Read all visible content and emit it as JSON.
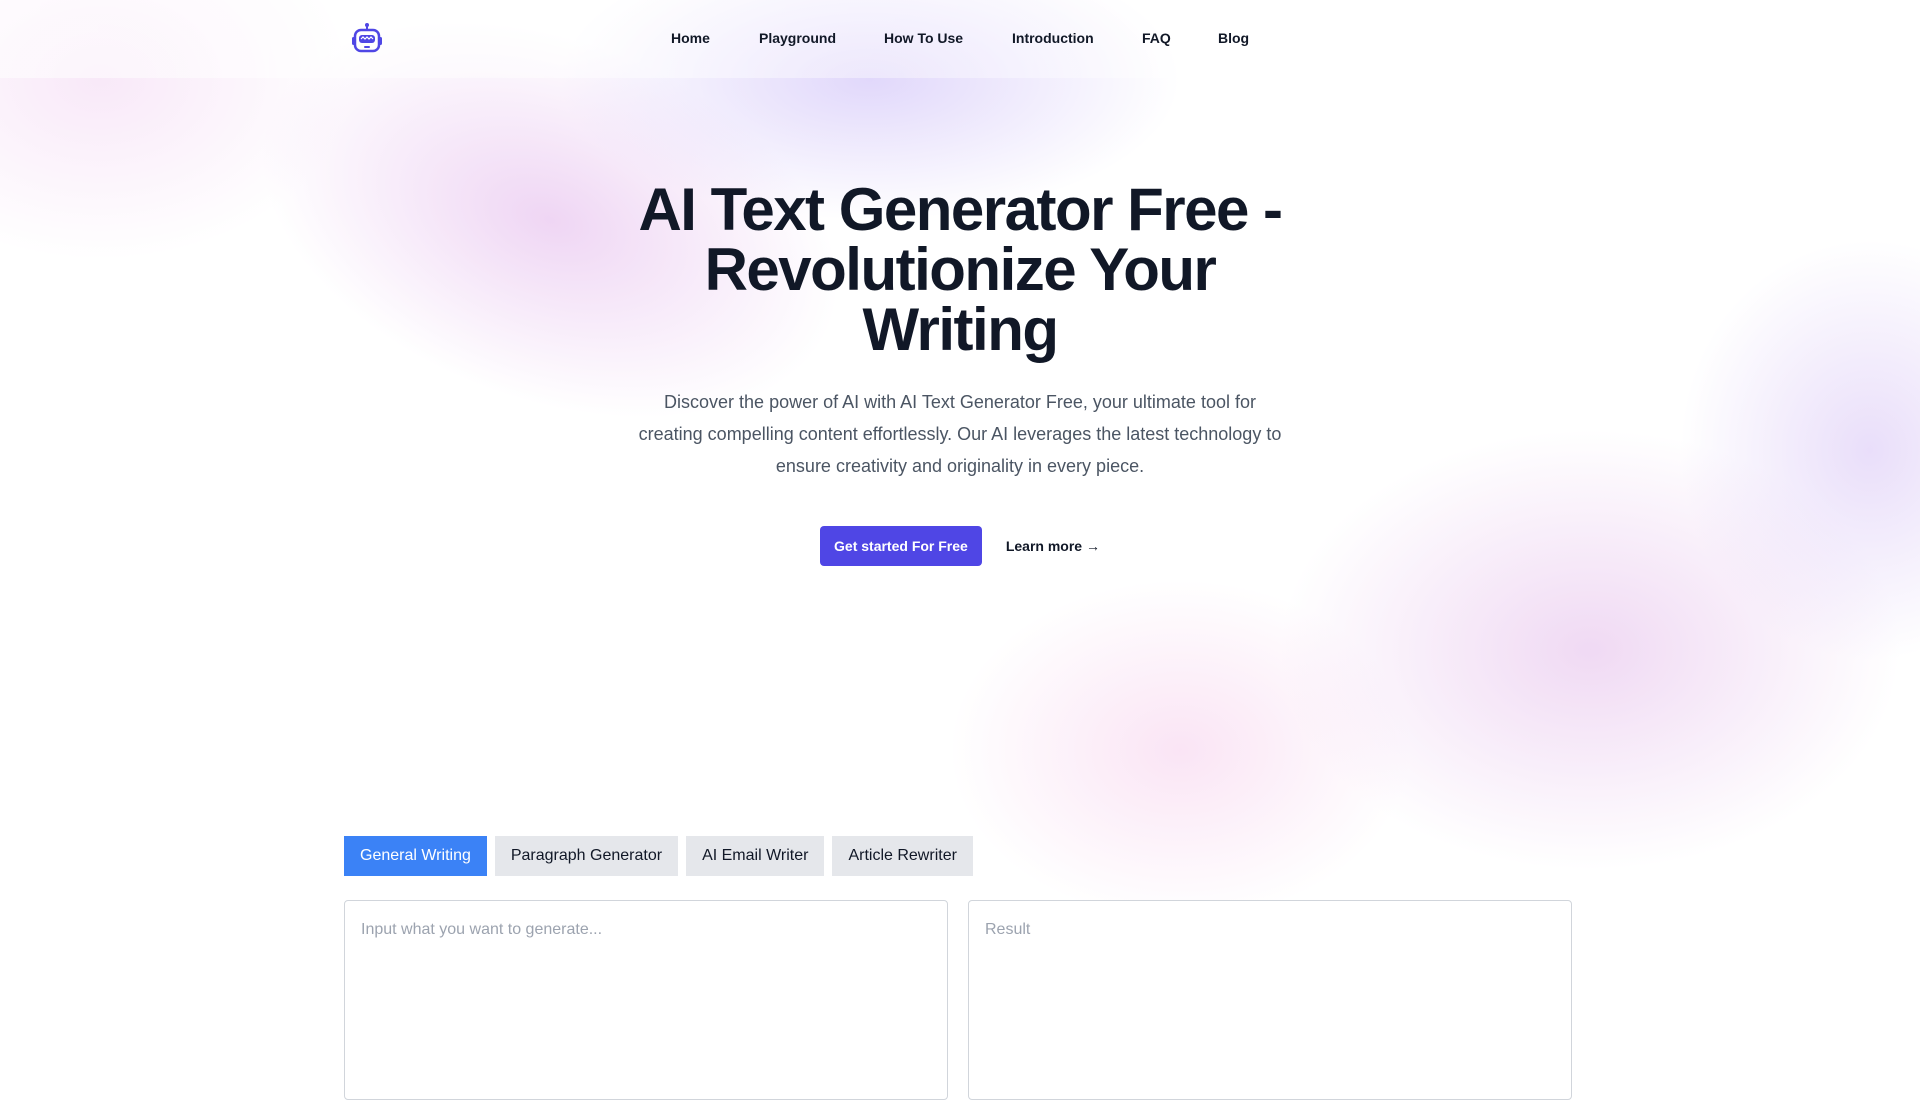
{
  "nav": {
    "logo": "robot-icon",
    "items": [
      {
        "label": "Home"
      },
      {
        "label": "Playground"
      },
      {
        "label": "How To Use"
      },
      {
        "label": "Introduction"
      },
      {
        "label": "FAQ"
      },
      {
        "label": "Blog"
      }
    ]
  },
  "hero": {
    "title": "AI Text Generator Free - Revolutionize Your Writing",
    "description": "Discover the power of AI with AI Text Generator Free, your ultimate tool for creating compelling content effortlessly. Our AI leverages the latest technology to ensure creativity and originality in every piece.",
    "primary_cta": "Get started For Free",
    "secondary_cta": "Learn more →"
  },
  "tabs": [
    {
      "label": "General Writing",
      "active": true
    },
    {
      "label": "Paragraph Generator",
      "active": false
    },
    {
      "label": "AI Email Writer",
      "active": false
    },
    {
      "label": "Article Rewriter",
      "active": false
    }
  ],
  "editor": {
    "input_placeholder": "Input what you want to generate...",
    "result_placeholder": "Result"
  },
  "colors": {
    "accent": "#4f46e5",
    "tab_active": "#3b82f6",
    "tab_inactive": "#e5e7eb"
  }
}
